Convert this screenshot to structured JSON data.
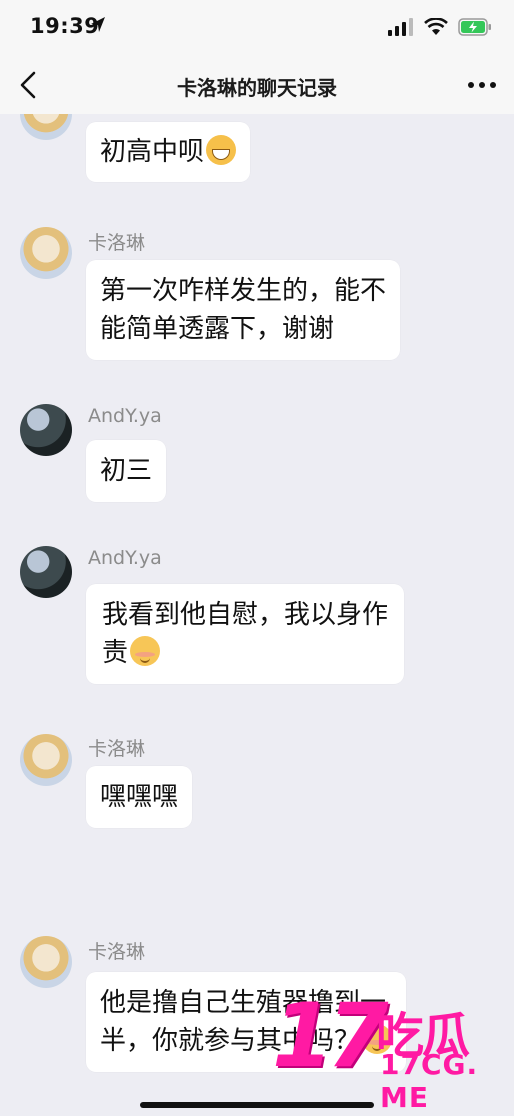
{
  "status_bar": {
    "time": "19:39"
  },
  "nav": {
    "title": "卡洛琳的聊天记录"
  },
  "messages": [
    {
      "sender": "",
      "text": "初高中呗",
      "emoji": "grin-emoji"
    },
    {
      "sender": "卡洛琳",
      "line1": "第一次咋样发生的，能不",
      "line2": "能简单透露下，谢谢"
    },
    {
      "sender": "AndY.ya",
      "text": "初三"
    },
    {
      "sender": "AndY.ya",
      "line1": "我看到他自慰，我以身作",
      "line2": "责",
      "emoji": "content-face-emoji"
    },
    {
      "sender": "卡洛琳",
      "text": "嘿嘿嘿"
    },
    {
      "sender": "卡洛琳",
      "line1": "他是撸自己生殖器撸到一",
      "line2": "半，你就参与其中吗？",
      "emoji": "content-face-emoji"
    }
  ],
  "watermark": {
    "number": "17",
    "chinese": "吃瓜",
    "domain": "17CG. ME"
  }
}
